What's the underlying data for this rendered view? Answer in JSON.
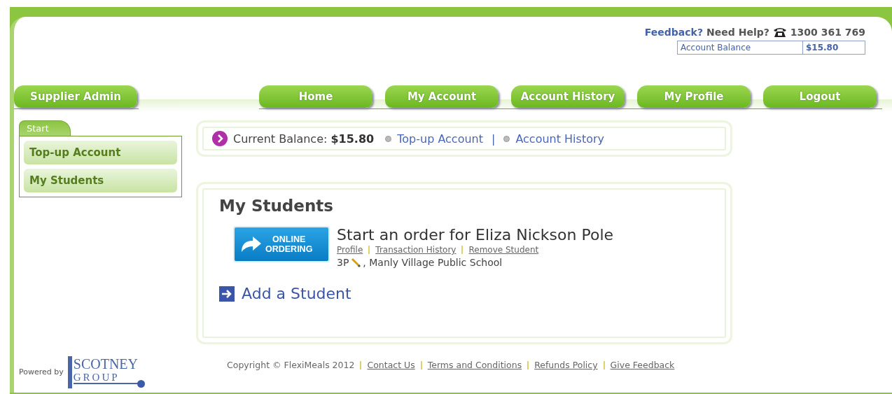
{
  "header": {
    "feedback_link": "Feedback?",
    "help_label": "Need Help?",
    "phone": "1300 361 769",
    "account_balance": {
      "label": "Account Balance",
      "value": "$15.80"
    }
  },
  "nav": {
    "admin_tab": "Supplier Admin",
    "tabs": [
      "Home",
      "My Account",
      "Account History",
      "My Profile",
      "Logout"
    ]
  },
  "sidebar": {
    "tab": "Start",
    "items": [
      "Top-up Account",
      "My Students"
    ]
  },
  "balance_bar": {
    "label": "Current Balance:",
    "value": "$15.80",
    "links": [
      "Top-up Account",
      "Account History"
    ],
    "separator": "|"
  },
  "students_panel": {
    "title": "My Students",
    "order_button": {
      "line1": "ONLINE",
      "line2": "ORDERING"
    },
    "students": [
      {
        "heading": "Start an order for Eliza Nickson Pole",
        "links": [
          "Profile",
          "Transaction History",
          "Remove Student"
        ],
        "class": "3P",
        "school": ", Manly Village Public School"
      }
    ],
    "add_link": "Add a Student"
  },
  "footer": {
    "powered_by": "Powered by",
    "logo": {
      "top": "SCOTNEY",
      "bottom": "GROUP"
    },
    "copyright": "Copyright © FlexiMeals 2012",
    "links": [
      "Contact Us",
      "Terms and Conditions",
      "Refunds Policy",
      "Give Feedback"
    ]
  }
}
